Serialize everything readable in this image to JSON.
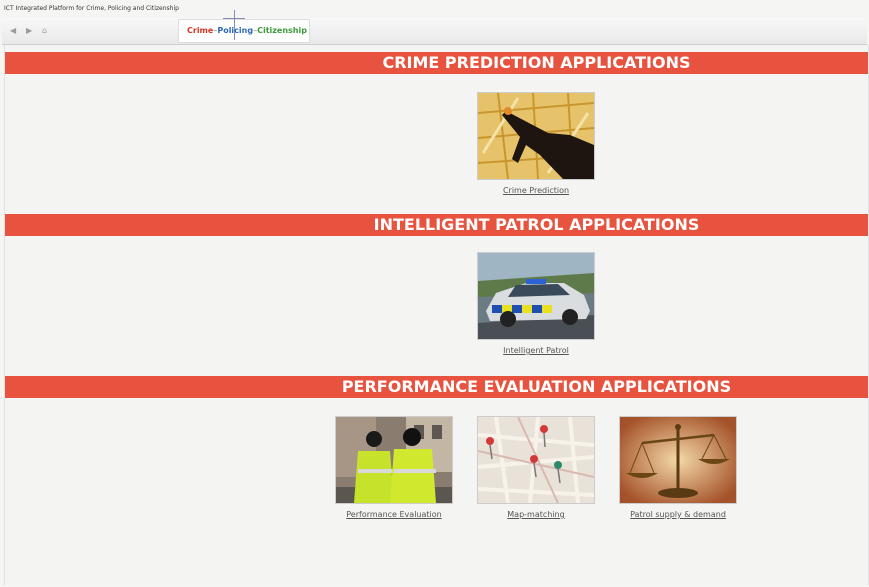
{
  "window": {
    "title": "ICT Integrated Platform for Crime, Policing and Citizenship"
  },
  "toolbar": {
    "back_glyph": "◀",
    "forward_glyph": "▶",
    "home_glyph": "⌂"
  },
  "logo": {
    "part1": "Crime",
    "part2": "Policing",
    "part3": "Citizenship",
    "separator": "–"
  },
  "sections": [
    {
      "heading": "CRIME PREDICTION APPLICATIONS",
      "apps": [
        {
          "label": "Crime Prediction",
          "icon": "hand-on-map-image"
        }
      ]
    },
    {
      "heading": "INTELLIGENT PATROL APPLICATIONS",
      "apps": [
        {
          "label": "Intelligent Patrol",
          "icon": "police-car-image"
        }
      ]
    },
    {
      "heading": "PERFORMANCE EVALUATION APPLICATIONS",
      "apps": [
        {
          "label": "Performance Evaluation",
          "icon": "police-officers-image"
        },
        {
          "label": "Map-matching",
          "icon": "map-pins-image"
        },
        {
          "label": "Patrol supply & demand",
          "icon": "scales-image"
        }
      ]
    }
  ],
  "colors": {
    "band": "#e8533f",
    "page_bg": "#f4f4f2"
  }
}
